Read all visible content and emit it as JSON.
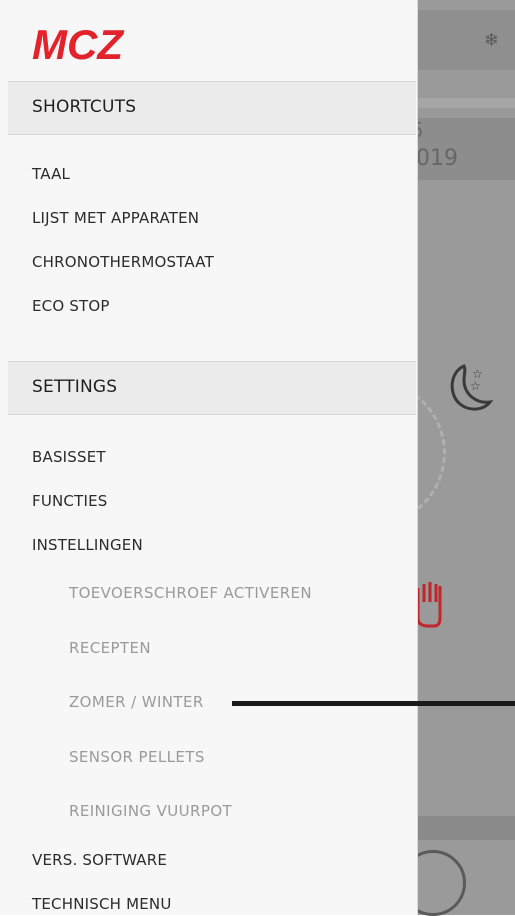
{
  "app": {
    "logo_text": "MCZ",
    "brand_color": "#e3232b"
  },
  "shortcuts": {
    "title": "SHORTCUTS",
    "items": [
      {
        "label": "TAAL"
      },
      {
        "label": "LIJST MET APPARATEN"
      },
      {
        "label": "CHRONOTHERMOSTAAT"
      },
      {
        "label": "ECO STOP"
      }
    ]
  },
  "settings": {
    "title": "SETTINGS",
    "items": [
      {
        "label": "BASISSET"
      },
      {
        "label": "FUNCTIES"
      },
      {
        "label": "INSTELLINGEN"
      }
    ],
    "sub_items": [
      {
        "label": "TOEVOERSCHROEF ACTIVEREN"
      },
      {
        "label": "RECEPTEN"
      },
      {
        "label": "ZOMER / WINTER"
      },
      {
        "label": "SENSOR PELLETS"
      },
      {
        "label": "REINIGING VUURPOT"
      }
    ],
    "bottom_items": [
      {
        "label": "VERS. SOFTWARE"
      },
      {
        "label": "TECHNISCH MENU"
      }
    ]
  },
  "background": {
    "date_top": "5",
    "date": "019",
    "icons": [
      "snowflake-icon",
      "moon-stars-icon",
      "hand-icon"
    ]
  }
}
